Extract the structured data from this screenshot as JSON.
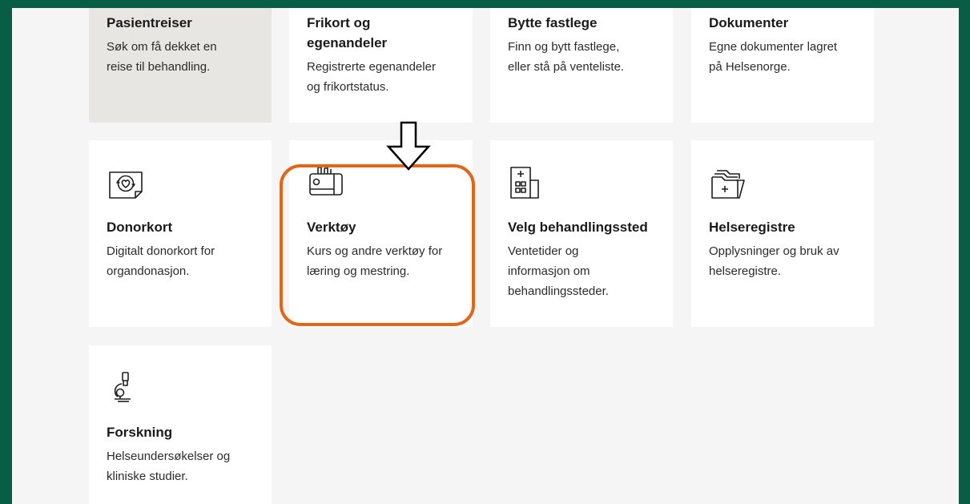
{
  "cards": {
    "pasientreiser": {
      "title": "Pasientreiser",
      "desc": "Søk om få dekket en reise til behandling."
    },
    "frikort": {
      "title": "Frikort og egenandeler",
      "desc": "Registrerte egenandeler og frikortstatus."
    },
    "fastlege": {
      "title": "Bytte fastlege",
      "desc": "Finn og bytt fastlege, eller stå på venteliste."
    },
    "dokumenter": {
      "title": "Dokumenter",
      "desc": "Egne dokumenter lagret på Helsenorge."
    },
    "donorkort": {
      "title": "Donorkort",
      "desc": "Digitalt donorkort for organdonasjon.",
      "icon": "donor-card-icon"
    },
    "verktoy": {
      "title": "Verktøy",
      "desc": "Kurs og andre verktøy for læring og mestring.",
      "icon": "toolbox-icon"
    },
    "behandlingssted": {
      "title": "Velg behandlingssted",
      "desc": "Ventetider og informasjon om behandlingssteder.",
      "icon": "hospital-icon"
    },
    "helseregistre": {
      "title": "Helseregistre",
      "desc": "Opplysninger og bruk av helseregistre.",
      "icon": "folder-plus-icon"
    },
    "forskning": {
      "title": "Forskning",
      "desc": "Helseundersøkelser og kliniske studier.",
      "icon": "microscope-icon"
    }
  },
  "colors": {
    "frame": "#075e45",
    "background": "#f5f5f5",
    "card": "#ffffff",
    "card_pressed": "#e7e6e2",
    "highlight": "#e0661a"
  }
}
